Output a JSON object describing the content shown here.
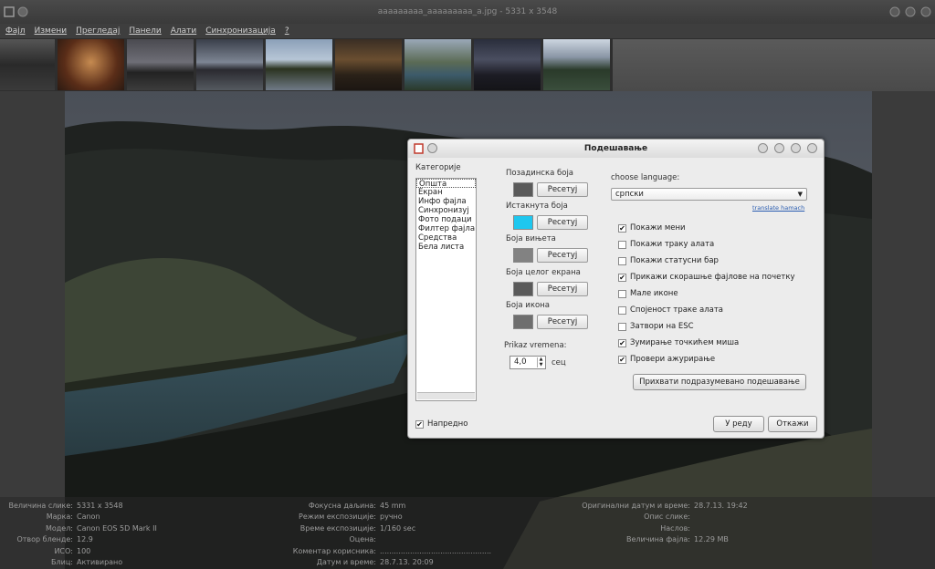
{
  "window": {
    "title": "aaaaaaaaa_aaaaaaaaa_a.jpg - 5331 x 3548"
  },
  "menu": [
    "Фајл",
    "Измени",
    "Прегледај",
    "Панели",
    "Алати",
    "Синхронизација",
    "?"
  ],
  "info": {
    "col1": [
      [
        "Величина слике:",
        "5331 x 3548"
      ],
      [
        "Марка:",
        "Canon"
      ],
      [
        "Модел:",
        "Canon EOS 5D Mark II"
      ],
      [
        "Отвор бленде:",
        "12.9"
      ],
      [
        "ИСО:",
        "100"
      ],
      [
        "Блиц:",
        "Активирано"
      ]
    ],
    "col2": [
      [
        "Фокусна даљина:",
        "45 mm"
      ],
      [
        "Режим експозиције:",
        "ручно"
      ],
      [
        "Време експозиције:",
        "1/160 sec"
      ],
      [
        "Оцена:",
        ""
      ],
      [
        "Коментар корисника:",
        "................................................"
      ],
      [
        "Датум и време:",
        "28.7.13. 20:09"
      ]
    ],
    "col3": [
      [
        "Оригинални датум и време:",
        "28.7.13. 19:42"
      ],
      [
        "Опис слике:",
        ""
      ],
      [
        "Наслов:",
        ""
      ],
      [
        "Величина фајла:",
        "12.29 MB"
      ]
    ]
  },
  "dialog": {
    "title": "Подешавање",
    "categories_label": "Категорије",
    "categories": [
      "Општа",
      "Екран",
      "Инфо фајла",
      "Синхронизуј",
      "Фото подаци",
      "Филтер фајла",
      "Средства",
      "Бела листа"
    ],
    "colors": [
      {
        "label": "Позадинска боја",
        "color": "#5a5a5a",
        "reset": "Ресетуј"
      },
      {
        "label": "Истакнута боја",
        "color": "#1ec7ef",
        "reset": "Ресетуј"
      },
      {
        "label": "Боја вињета",
        "color": "#828282",
        "reset": "Ресетуј"
      },
      {
        "label": "Боја целог екрана",
        "color": "#5a5a5a",
        "reset": "Ресетуј"
      },
      {
        "label": "Боја икона",
        "color": "#6e6e6e",
        "reset": "Ресетуј"
      }
    ],
    "time_label": "Prikaz vremena:",
    "time_value": "4,0",
    "time_unit": "сец",
    "language_label": "choose language:",
    "language_value": "српски",
    "translate_link": "translate hamach",
    "options": [
      {
        "label": "Покажи мени",
        "checked": true
      },
      {
        "label": "Покажи траку алата",
        "checked": false
      },
      {
        "label": "Покажи статусни бар",
        "checked": false
      },
      {
        "label": "Прикажи скорашње фајлове на почетку",
        "checked": true
      },
      {
        "label": "Мале иконе",
        "checked": false
      },
      {
        "label": "Спојеност траке алата",
        "checked": false
      },
      {
        "label": "Затвори на ESC",
        "checked": false
      },
      {
        "label": "Зумирање точкићем миша",
        "checked": true
      },
      {
        "label": "Провери ажурирање",
        "checked": true
      }
    ],
    "defaults_button": "Прихвати подразумевано подешавање",
    "advanced_label": "Напредно",
    "ok_button": "У реду",
    "cancel_button": "Откажи"
  }
}
